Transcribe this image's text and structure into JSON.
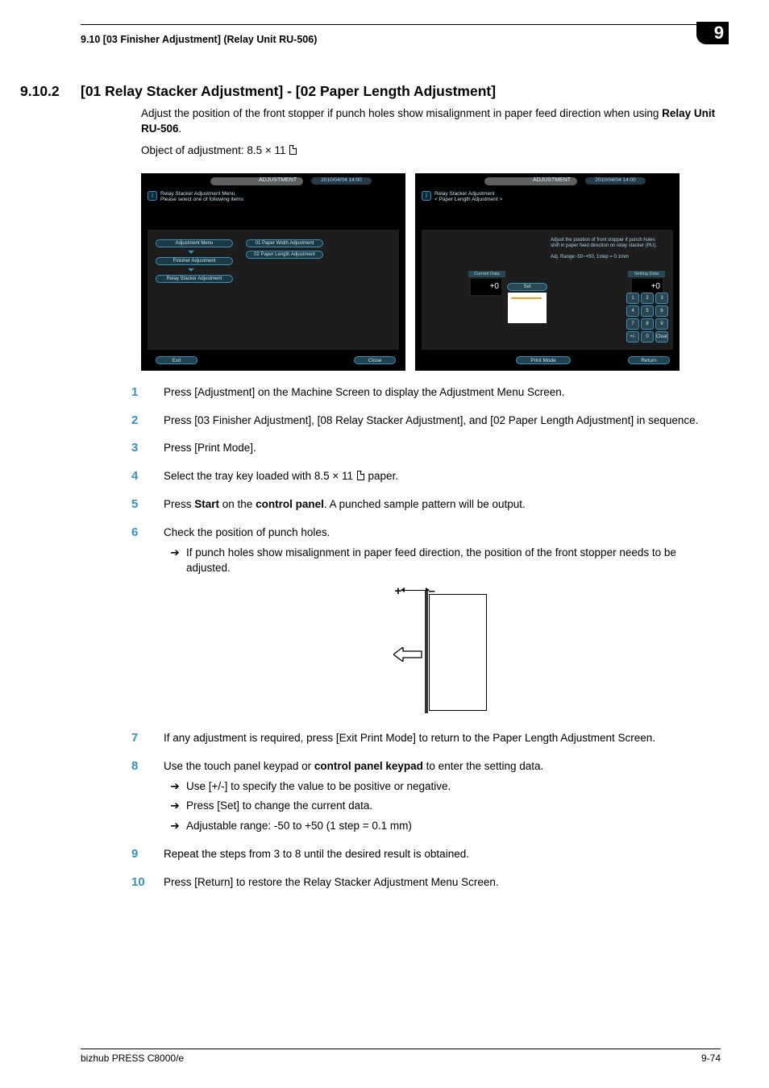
{
  "header": {
    "left": "9.10    [03 Finisher Adjustment] (Relay Unit RU-506)",
    "chapter": "9"
  },
  "section": {
    "number": "9.10.2",
    "title": "[01 Relay Stacker Adjustment] - [02 Paper Length Adjustment]"
  },
  "intro_line1_pre": "Adjust the position of the front stopper if punch holes show misalignment in paper feed direction when using ",
  "intro_line1_bold": "Relay Unit RU-506",
  "intro_line1_post": ".",
  "object_line": "Object of adjustment: 8.5 × 11 ",
  "screens": {
    "top_label": "ADJUSTMENT",
    "date": "2010/04/04  14:00",
    "left": {
      "header1": "Relay Stacker Adjustment Menu",
      "header2": "Please select one of following items",
      "menu1": "Adjustment Menu",
      "menu2": "Finisher Adjustment",
      "menu3": "Relay Stacker Adjustment",
      "item1": "01 Paper Width Adjustment",
      "item2": "02 Paper Length Adjustment",
      "exit": "Exit",
      "close": "Close"
    },
    "right": {
      "header1": "Relay Stacker Adjustment",
      "header2": "< Paper Length Adjustment >",
      "help1": "Adjust the position of front stopper if punch holes",
      "help2": "shift in paper feed direction on relay stacker (RU).",
      "adj_range": "Adj. Range:-50~+50, 1step = 0.1mm",
      "current_label": "Current Data",
      "current_value": "+0",
      "setting_label": "Setting Data",
      "setting_value": "+0",
      "set": "Set",
      "small_label": "~~~~~~~",
      "print": "Print Mode",
      "return": "Return",
      "keys": [
        "1",
        "2",
        "3",
        "4",
        "5",
        "6",
        "7",
        "8",
        "9",
        "+/-",
        "0",
        "Clear"
      ]
    }
  },
  "steps": {
    "1": "Press [Adjustment] on the Machine Screen to display the Adjustment Menu Screen.",
    "2": "Press [03 Finisher Adjustment], [08 Relay Stacker Adjustment], and [02 Paper Length Adjustment] in sequence.",
    "3": "Press [Print Mode].",
    "4_pre": "Select the tray key loaded with 8.5 × 11 ",
    "4_post": " paper.",
    "5_pre": "Press ",
    "5_b1": "Start",
    "5_mid": " on the ",
    "5_b2": "control panel",
    "5_post": ". A punched sample pattern will be output.",
    "6": "Check the position of punch holes.",
    "6_sub": "If punch holes show misalignment in paper feed direction, the position of the front stopper needs to be adjusted.",
    "7": "If any adjustment is required, press [Exit Print Mode] to return to the Paper Length Adjustment Screen.",
    "8_pre": "Use the touch panel keypad or ",
    "8_b": "control panel keypad",
    "8_post": " to enter the setting data.",
    "8_sub1": "Use [+/-] to specify the value to be positive or negative.",
    "8_sub2": "Press [Set] to change the current data.",
    "8_sub3": "Adjustable range: -50 to +50 (1 step = 0.1 mm)",
    "9": "Repeat the steps from 3 to 8 until the desired result is obtained.",
    "10": "Press [Return] to restore the Relay Stacker Adjustment Menu Screen."
  },
  "diagram": {
    "plus": "+",
    "minus": "–"
  },
  "footer": {
    "left": "bizhub PRESS C8000/e",
    "right": "9-74"
  },
  "nums": {
    "1": "1",
    "2": "2",
    "3": "3",
    "4": "4",
    "5": "5",
    "6": "6",
    "7": "7",
    "8": "8",
    "9": "9",
    "10": "10"
  }
}
